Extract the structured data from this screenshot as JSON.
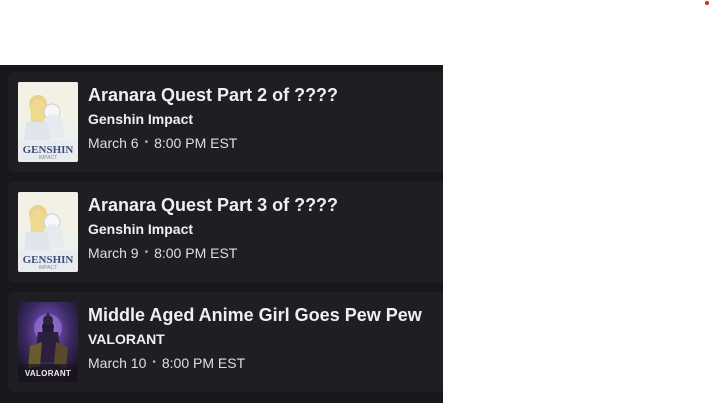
{
  "schedule": {
    "items": [
      {
        "title": "Aranara Quest Part 2 of ????",
        "game": "Genshin Impact",
        "date": "March 6",
        "separator": "•",
        "time": "8:00 PM EST",
        "thumb_icon": "genshin-impact-boxart-icon",
        "thumb_text": "GENSHIN",
        "thumb_subtext": "IMPACT"
      },
      {
        "title": "Aranara Quest Part 3 of ????",
        "game": "Genshin Impact",
        "date": "March 9",
        "separator": "•",
        "time": "8:00 PM EST",
        "thumb_icon": "genshin-impact-boxart-icon",
        "thumb_text": "GENSHIN",
        "thumb_subtext": "IMPACT"
      },
      {
        "title": "Middle Aged Anime Girl Goes Pew Pew",
        "game": "VALORANT",
        "date": "March 10",
        "separator": "•",
        "time": "8:00 PM EST",
        "thumb_icon": "valorant-boxart-icon",
        "thumb_text": "VALORANT"
      }
    ]
  },
  "colors": {
    "panel_bg": "#18181b",
    "card_bg": "#1f1f23",
    "text_primary": "#efeff1",
    "text_secondary": "#dedee3"
  }
}
